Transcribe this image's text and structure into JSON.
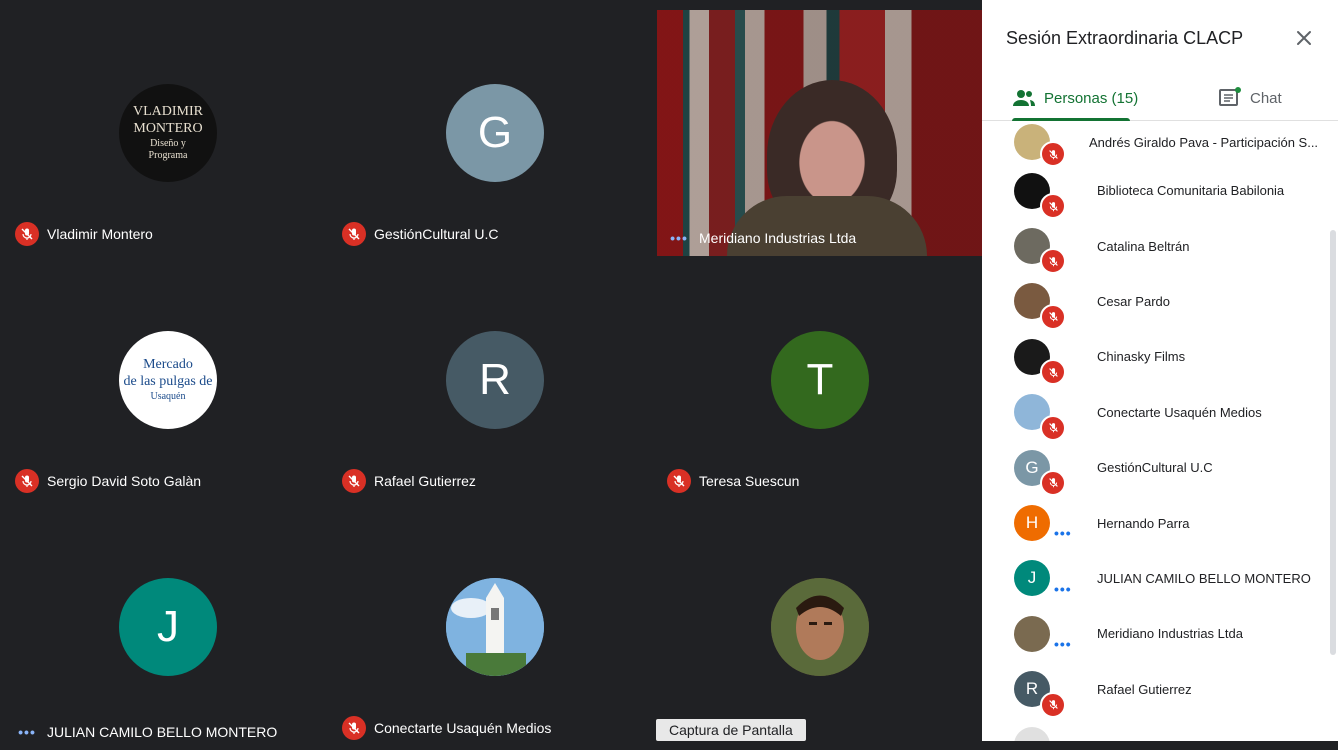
{
  "meeting": {
    "title": "Sesión Extraordinaria CLACP",
    "tooltip": "Captura de Pantalla"
  },
  "tiles": [
    {
      "name": "Vladimir Montero",
      "status": "muted",
      "avatar_text": "",
      "logo_lines": [
        "VLADIMIR",
        "MONTERO",
        "Diseño y",
        "Programa"
      ],
      "color": "#111111"
    },
    {
      "name": "GestiónCultural U.C",
      "status": "muted",
      "avatar_text": "G",
      "color": "#7b97a6"
    },
    {
      "name": "Meridiano Industrias Ltda",
      "status": "speaking",
      "avatar_text": "",
      "color": "#5a3a30"
    },
    {
      "name": "Sergio David Soto Galàn",
      "status": "muted",
      "avatar_text": "",
      "logo_lines": [
        "Mercado",
        "de las pulgas de",
        "Usaquén"
      ],
      "color": "#ffffff"
    },
    {
      "name": "Rafael Gutierrez",
      "status": "muted",
      "avatar_text": "R",
      "color": "#465a65"
    },
    {
      "name": "Teresa Suescun",
      "status": "muted",
      "avatar_text": "T",
      "color": "#33691e"
    },
    {
      "name": "JULIAN CAMILO BELLO MONTERO",
      "status": "speaking",
      "avatar_text": "J",
      "color": "#00897b"
    },
    {
      "name": "Conectarte Usaquén Medios",
      "status": "muted",
      "avatar_text": "",
      "color": "#6aa6d6"
    },
    {
      "name": "",
      "status": "none",
      "avatar_text": "",
      "color": "#6b4a3a"
    }
  ],
  "panel": {
    "tabs": {
      "people": "Personas (15)",
      "chat": "Chat"
    },
    "participants": [
      {
        "name": "Andrés Giraldo Pava - Participación S...",
        "status": "muted",
        "avatar_text": "",
        "color": "#c9b27a"
      },
      {
        "name": "Biblioteca Comunitaria Babilonia",
        "status": "muted",
        "avatar_text": "",
        "color": "#111111"
      },
      {
        "name": "Catalina Beltrán",
        "status": "muted",
        "avatar_text": "",
        "color": "#6d6a60"
      },
      {
        "name": "Cesar Pardo",
        "status": "muted",
        "avatar_text": "",
        "color": "#7a5a40"
      },
      {
        "name": "Chinasky Films",
        "status": "muted",
        "avatar_text": "",
        "color": "#1a1a1a"
      },
      {
        "name": "Conectarte Usaquén Medios",
        "status": "muted",
        "avatar_text": "",
        "color": "#8fb6d9"
      },
      {
        "name": "GestiónCultural U.C",
        "status": "muted",
        "avatar_text": "G",
        "color": "#7b97a6"
      },
      {
        "name": "Hernando Parra",
        "status": "speaking",
        "avatar_text": "H",
        "color": "#ef6c00"
      },
      {
        "name": "JULIAN CAMILO BELLO MONTERO",
        "status": "speaking",
        "avatar_text": "J",
        "color": "#00897b"
      },
      {
        "name": "Meridiano Industrias Ltda",
        "status": "speaking",
        "avatar_text": "",
        "color": "#7a6a50"
      },
      {
        "name": "Rafael Gutierrez",
        "status": "muted",
        "avatar_text": "R",
        "color": "#465a65"
      },
      {
        "name": "",
        "status": "none",
        "avatar_text": "",
        "color": "#e0e0e0"
      }
    ]
  }
}
